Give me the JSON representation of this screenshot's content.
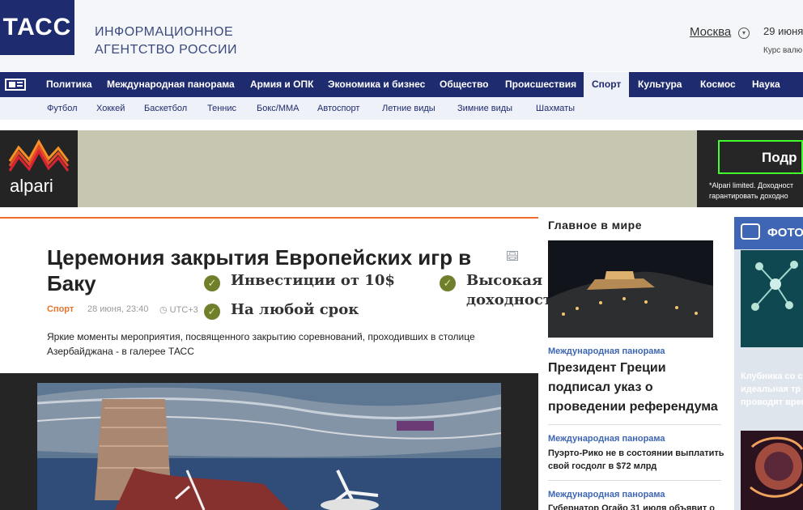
{
  "header": {
    "logo": "ТАСС",
    "agency_line1": "ИНФОРМАЦИОННОЕ",
    "agency_line2": "АГЕНТСТВО РОССИИ",
    "city": "Москва",
    "date": "29 июня",
    "rates": "Курс валю"
  },
  "nav": {
    "items": [
      "Политика",
      "Международная панорама",
      "Армия и ОПК",
      "Экономика и бизнес",
      "Общество",
      "Происшествия",
      "Спорт",
      "Культура",
      "Космос",
      "Наука"
    ],
    "active": "Спорт"
  },
  "subnav": {
    "items": [
      "Футбол",
      "Хоккей",
      "Баскетбол",
      "Теннис",
      "Бокс/ММА",
      "Автоспорт",
      "Летние виды",
      "Зимние виды",
      "Шахматы"
    ]
  },
  "ad": {
    "brand": "alpari",
    "lines": [
      "Инвестиции от 10$",
      "На любой срок",
      "Высокая",
      "доходность*"
    ],
    "button": "Подр",
    "note_line1": "*Alpari limited. Доходност",
    "note_line2": "гарантировать доходно"
  },
  "article": {
    "title": "Церемония закрытия Европейских игр в Баку",
    "category": "Спорт",
    "date": "28 июня, 23:40",
    "utc": "UTC+3",
    "lead": "Яркие моменты мероприятия, посвященного закрытию соревнований, проходивших в столице Азербайджана - в галерее ТАСС"
  },
  "right": {
    "title": "Главное в мире",
    "story1_cat": "Международная панорама",
    "story1_head": "Президент Греции подписал указ о проведении референдума",
    "story2_cat": "Международная панорама",
    "story2_head": "Пуэрто-Рико не в состоянии выплатить свой госдолг в $72 млрд",
    "story3_cat": "Международная панорама",
    "story3_head": "Губернатор Огайо 31 июля объявит о"
  },
  "photo": {
    "label": "ФОТО",
    "caption_line1": "Клубника со с",
    "caption_line2": "идеальная тр",
    "caption_line3": "проводят врем"
  },
  "colors": {
    "brand": "#1f2b6f",
    "accent": "#f26b2c",
    "link": "#3f66b4"
  }
}
